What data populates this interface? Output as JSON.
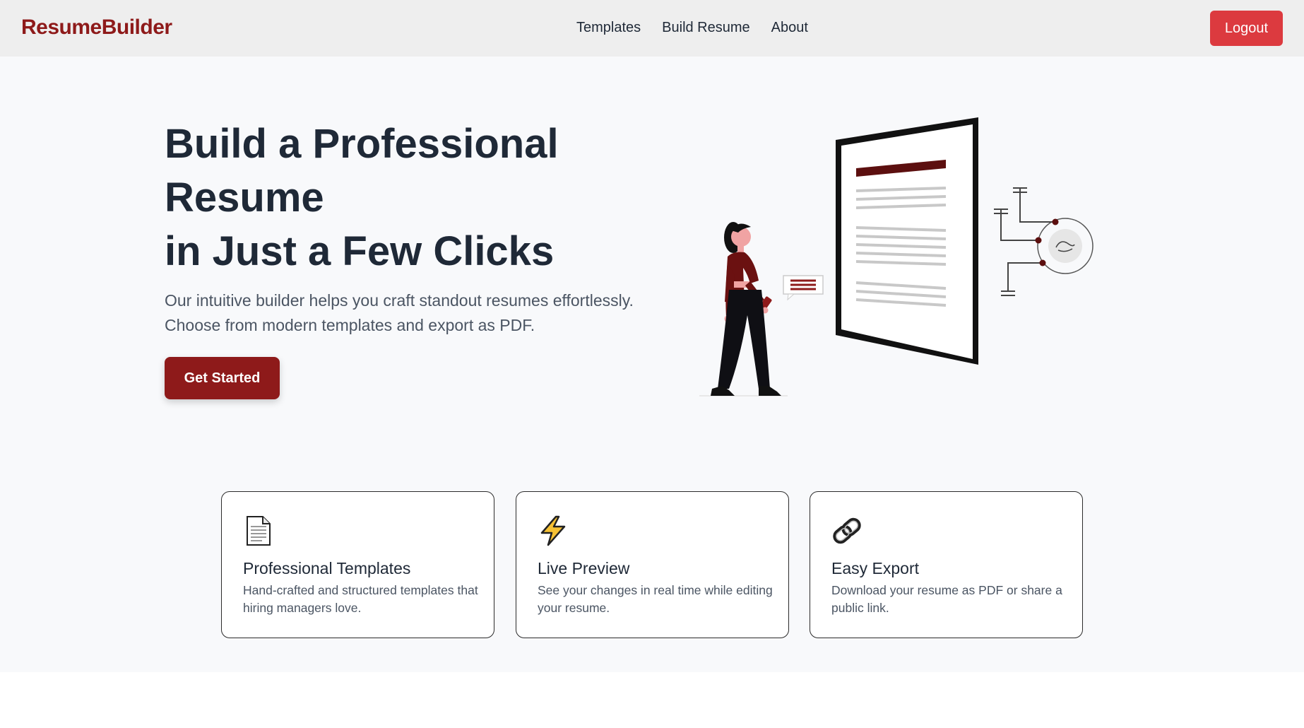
{
  "navbar": {
    "brand": "ResumeBuilder",
    "links": [
      "Templates",
      "Build Resume",
      "About"
    ],
    "logout_label": "Logout"
  },
  "hero": {
    "title_lines": [
      "Build a Professional",
      "Resume",
      "in Just a Few Clicks"
    ],
    "subtitle_lines": [
      "Our intuitive builder helps you craft standout resumes effortlessly.",
      "Choose from modern templates and export as PDF."
    ],
    "cta_label": "Get Started"
  },
  "features": [
    {
      "icon": "document-icon",
      "title": "Professional Templates",
      "description": "Hand-crafted and structured templates that hiring managers love."
    },
    {
      "icon": "lightning-icon",
      "title": "Live Preview",
      "description": "See your changes in real time while editing your resume."
    },
    {
      "icon": "link-icon",
      "title": "Easy Export",
      "description": "Download your resume as PDF or share a public link."
    }
  ],
  "colors": {
    "brand": "#8e1a1a",
    "logout": "#dc3a3f",
    "cta": "#8e1a1a",
    "navbar_bg": "#eeeeee",
    "hero_bg": "#f8f9fb"
  }
}
